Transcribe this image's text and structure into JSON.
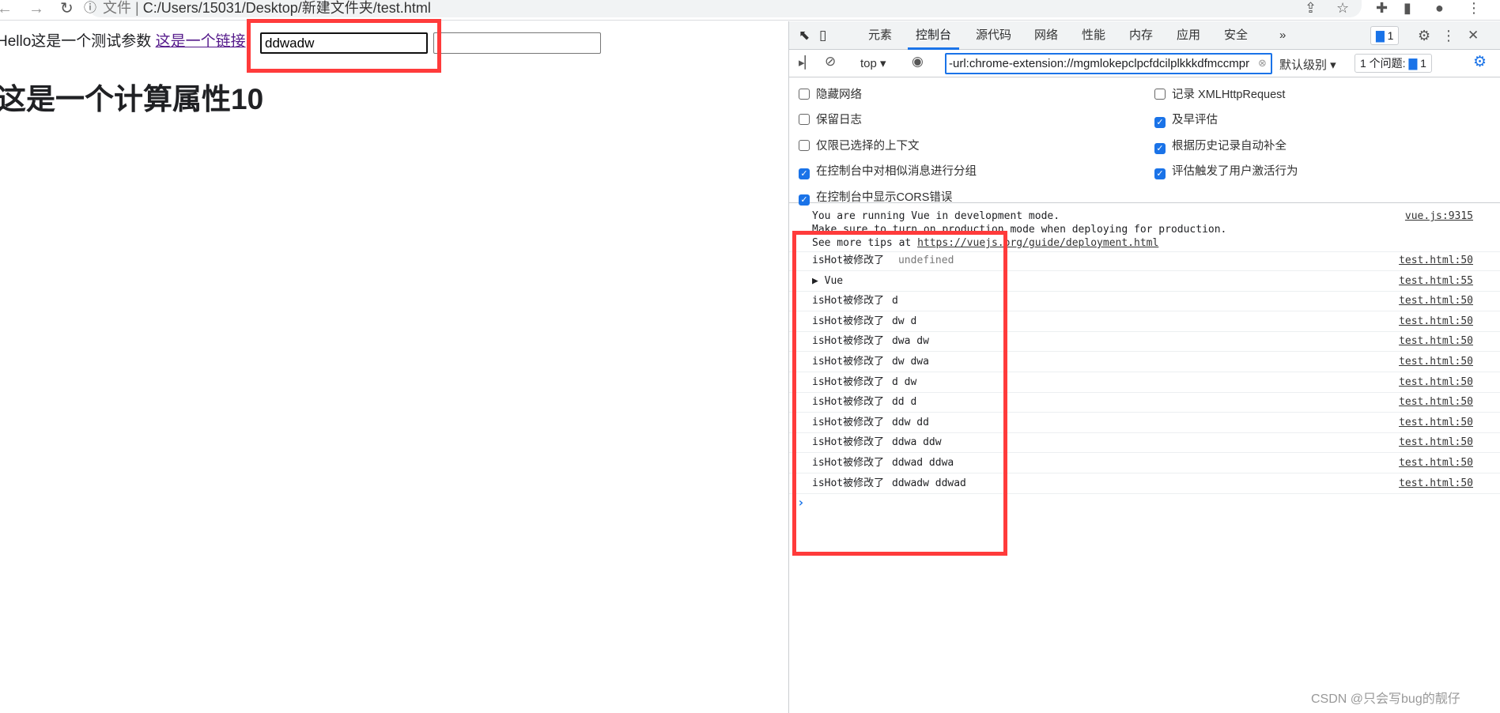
{
  "browser": {
    "url_prefix": "文件 |",
    "url": "C:/Users/15031/Desktop/新建文件夹/test.html"
  },
  "page": {
    "hello_text": "Hello这是一个测试参数",
    "link_text": "这是一个链接",
    "input1_value": "ddwadw",
    "input2_value": "",
    "heading": "这是一个计算属性10"
  },
  "devtools": {
    "tabs": [
      "元素",
      "控制台",
      "源代码",
      "网络",
      "性能",
      "内存",
      "应用",
      "安全"
    ],
    "active_tab": "控制台",
    "more_tabs": "»",
    "issues_badge_count": "1",
    "toolbar": {
      "context": "top",
      "filter_value": "-url:chrome-extension://mgmlokepclpcfdcilplkkkdfmccmpr",
      "level": "默认级别",
      "issues_label": "1 个问题:",
      "issues_count": "1"
    },
    "settings_left": [
      {
        "label": "隐藏网络",
        "checked": false
      },
      {
        "label": "保留日志",
        "checked": false
      },
      {
        "label": "仅限已选择的上下文",
        "checked": false
      },
      {
        "label": "在控制台中对相似消息进行分组",
        "checked": true
      },
      {
        "label": "在控制台中显示CORS错误",
        "checked": true
      }
    ],
    "settings_right": [
      {
        "label": "记录 XMLHttpRequest",
        "checked": false
      },
      {
        "label": "及早评估",
        "checked": true
      },
      {
        "label": "根据历史记录自动补全",
        "checked": true
      },
      {
        "label": "评估触发了用户激活行为",
        "checked": true
      }
    ],
    "console": {
      "vue_msg": {
        "line1": "You are running Vue in development mode.",
        "line2": "Make sure to turn on production mode when deploying for production.",
        "line3_prefix": "See more tips at ",
        "line3_link": "https://vuejs.org/guide/deployment.html",
        "source": "vue.js:9315"
      },
      "messages": [
        {
          "text": "isHot被修改了",
          "args": "undefined",
          "muted": true,
          "source": "test.html:50"
        },
        {
          "text": "▶ Vue",
          "args": "",
          "source": "test.html:55"
        },
        {
          "text": "isHot被修改了",
          "args": "d",
          "source": "test.html:50"
        },
        {
          "text": "isHot被修改了",
          "args": "dw d",
          "source": "test.html:50"
        },
        {
          "text": "isHot被修改了",
          "args": "dwa dw",
          "source": "test.html:50"
        },
        {
          "text": "isHot被修改了",
          "args": "dw dwa",
          "source": "test.html:50"
        },
        {
          "text": "isHot被修改了",
          "args": "d dw",
          "source": "test.html:50"
        },
        {
          "text": "isHot被修改了",
          "args": "dd d",
          "source": "test.html:50"
        },
        {
          "text": "isHot被修改了",
          "args": "ddw dd",
          "source": "test.html:50"
        },
        {
          "text": "isHot被修改了",
          "args": "ddwa ddw",
          "source": "test.html:50"
        },
        {
          "text": "isHot被修改了",
          "args": "ddwad ddwa",
          "source": "test.html:50"
        },
        {
          "text": "isHot被修改了",
          "args": "ddwadw ddwad",
          "source": "test.html:50"
        }
      ],
      "prompt": "›"
    }
  },
  "watermark": "CSDN @只会写bug的靓仔",
  "colors": {
    "accent": "#1a73e8",
    "annotation_red": "#ff3b3b",
    "visited_link": "#551a8b"
  }
}
